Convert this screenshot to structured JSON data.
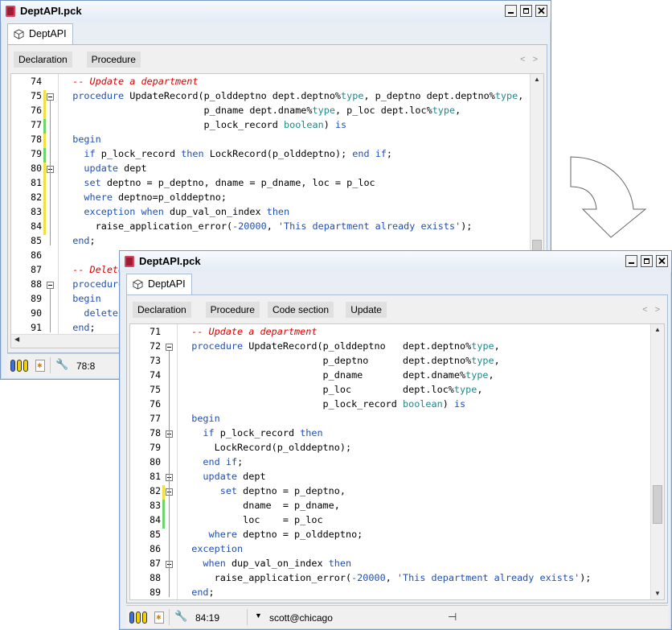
{
  "back_window": {
    "title": "DeptAPI.pck",
    "tab_label": "DeptAPI",
    "nav_buttons": [
      "Declaration",
      "Procedure"
    ],
    "nav_arrows": "< >",
    "line_numbers": [
      "74",
      "75",
      "76",
      "77",
      "78",
      "79",
      "80",
      "81",
      "82",
      "83",
      "84",
      "85",
      "86",
      "87",
      "88",
      "89",
      "90",
      "91"
    ],
    "code_lines": [
      "  -- Update a department",
      "  procedure UpdateRecord(p_olddeptno dept.deptno%type, p_deptno dept.deptno%type,",
      "                         p_dname dept.dname%type, p_loc dept.loc%type,",
      "                         p_lock_record boolean) is",
      "  begin",
      "    if p_lock_record then LockRecord(p_olddeptno); end if;",
      "    update dept",
      "    set deptno = p_deptno, dname = p_dname, loc = p_loc",
      "    where deptno=p_olddeptno;",
      "    exception when dup_val_on_index then",
      "      raise_application_error(-20000, 'This department already exists');",
      "  end;",
      "",
      "  -- Delete a department",
      "  procedure DeleteRecord",
      "  begin",
      "    delete",
      "  end;"
    ],
    "status_position": "78:8"
  },
  "front_window": {
    "title": "DeptAPI.pck",
    "tab_label": "DeptAPI",
    "nav_buttons": [
      "Declaration",
      "Procedure",
      "Code section",
      "Update"
    ],
    "nav_arrows": "< >",
    "line_numbers": [
      "71",
      "72",
      "73",
      "74",
      "75",
      "76",
      "77",
      "78",
      "79",
      "80",
      "81",
      "82",
      "83",
      "84",
      "85",
      "86",
      "87",
      "88",
      "89"
    ],
    "code_lines": [
      "  -- Update a department",
      "  procedure UpdateRecord(p_olddeptno   dept.deptno%type,",
      "                         p_deptno      dept.deptno%type,",
      "                         p_dname       dept.dname%type,",
      "                         p_loc         dept.loc%type,",
      "                         p_lock_record boolean) is",
      "  begin",
      "    if p_lock_record then",
      "      LockRecord(p_olddeptno);",
      "    end if;",
      "    update dept",
      "       set deptno = p_deptno,",
      "           dname  = p_dname,",
      "           loc    = p_loc",
      "     where deptno = p_olddeptno;",
      "  exception",
      "    when dup_val_on_index then",
      "      raise_application_error(-20000, 'This department already exists');",
      "  end;"
    ],
    "status_position": "84:19",
    "status_connection": "scott@chicago"
  },
  "icons": {
    "title_icon": "package-icon",
    "tab_icon": "cube-icon",
    "arrow": "curved-arrow-down-icon",
    "status": [
      "color-pills-icon",
      "document-star-icon",
      "wrench-icon",
      "pin-icon",
      "dropdown-icon"
    ]
  },
  "colors": {
    "keyword": "#1f4fb5",
    "type": "#1f8a8a",
    "comment": "#e00000",
    "window_border": "#7a9cc4",
    "change_marker_yellow": "#f0e040",
    "change_marker_green": "#6cd66c"
  }
}
